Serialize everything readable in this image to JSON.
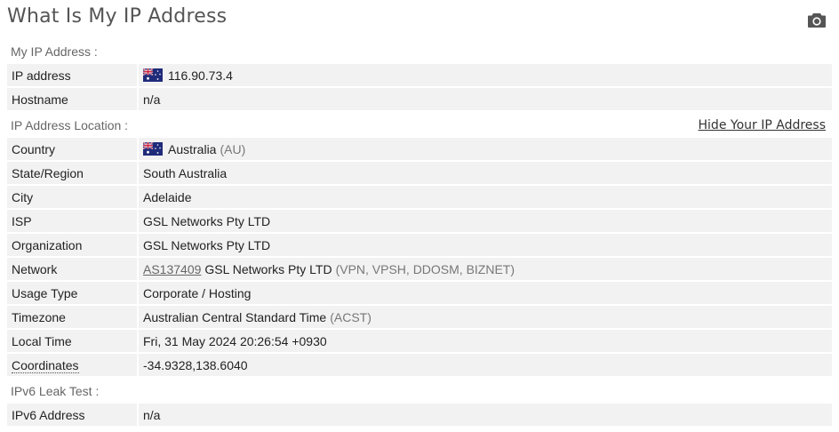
{
  "header": {
    "title": "What Is My IP Address",
    "camera_icon": "camera-icon"
  },
  "my_ip": {
    "section_label": "My IP Address :",
    "rows": {
      "ip": {
        "label": "IP address",
        "value": "116.90.73.4",
        "flag": "australia-flag-icon"
      },
      "hostname": {
        "label": "Hostname",
        "value": "n/a"
      }
    }
  },
  "location": {
    "section_label": "IP Address Location :",
    "hide_link": "Hide Your IP Address",
    "rows": {
      "country": {
        "label": "Country",
        "value": "Australia",
        "code": "(AU)",
        "flag": "australia-flag-icon"
      },
      "state": {
        "label": "State/Region",
        "value": "South Australia"
      },
      "city": {
        "label": "City",
        "value": "Adelaide"
      },
      "isp": {
        "label": "ISP",
        "value": "GSL Networks Pty LTD"
      },
      "organization": {
        "label": "Organization",
        "value": "GSL Networks Pty LTD"
      },
      "network": {
        "label": "Network",
        "asn": "AS137409",
        "value": "GSL Networks Pty LTD",
        "tags": "(VPN, VPSH, DDOSM, BIZNET)"
      },
      "usage": {
        "label": "Usage Type",
        "value": "Corporate / Hosting"
      },
      "timezone": {
        "label": "Timezone",
        "value": "Australian Central Standard Time",
        "abbr": "(ACST)"
      },
      "localtime": {
        "label": "Local Time",
        "value": "Fri, 31 May 2024 20:26:54 +0930"
      },
      "coordinates": {
        "label": "Coordinates",
        "value": "-34.9328,138.6040"
      }
    }
  },
  "ipv6": {
    "section_label": "IPv6 Leak Test :",
    "rows": {
      "address": {
        "label": "IPv6 Address",
        "value": "n/a"
      }
    }
  },
  "colors": {
    "row_bg": "#f2f2f2",
    "title": "#555555",
    "muted": "#777777"
  }
}
